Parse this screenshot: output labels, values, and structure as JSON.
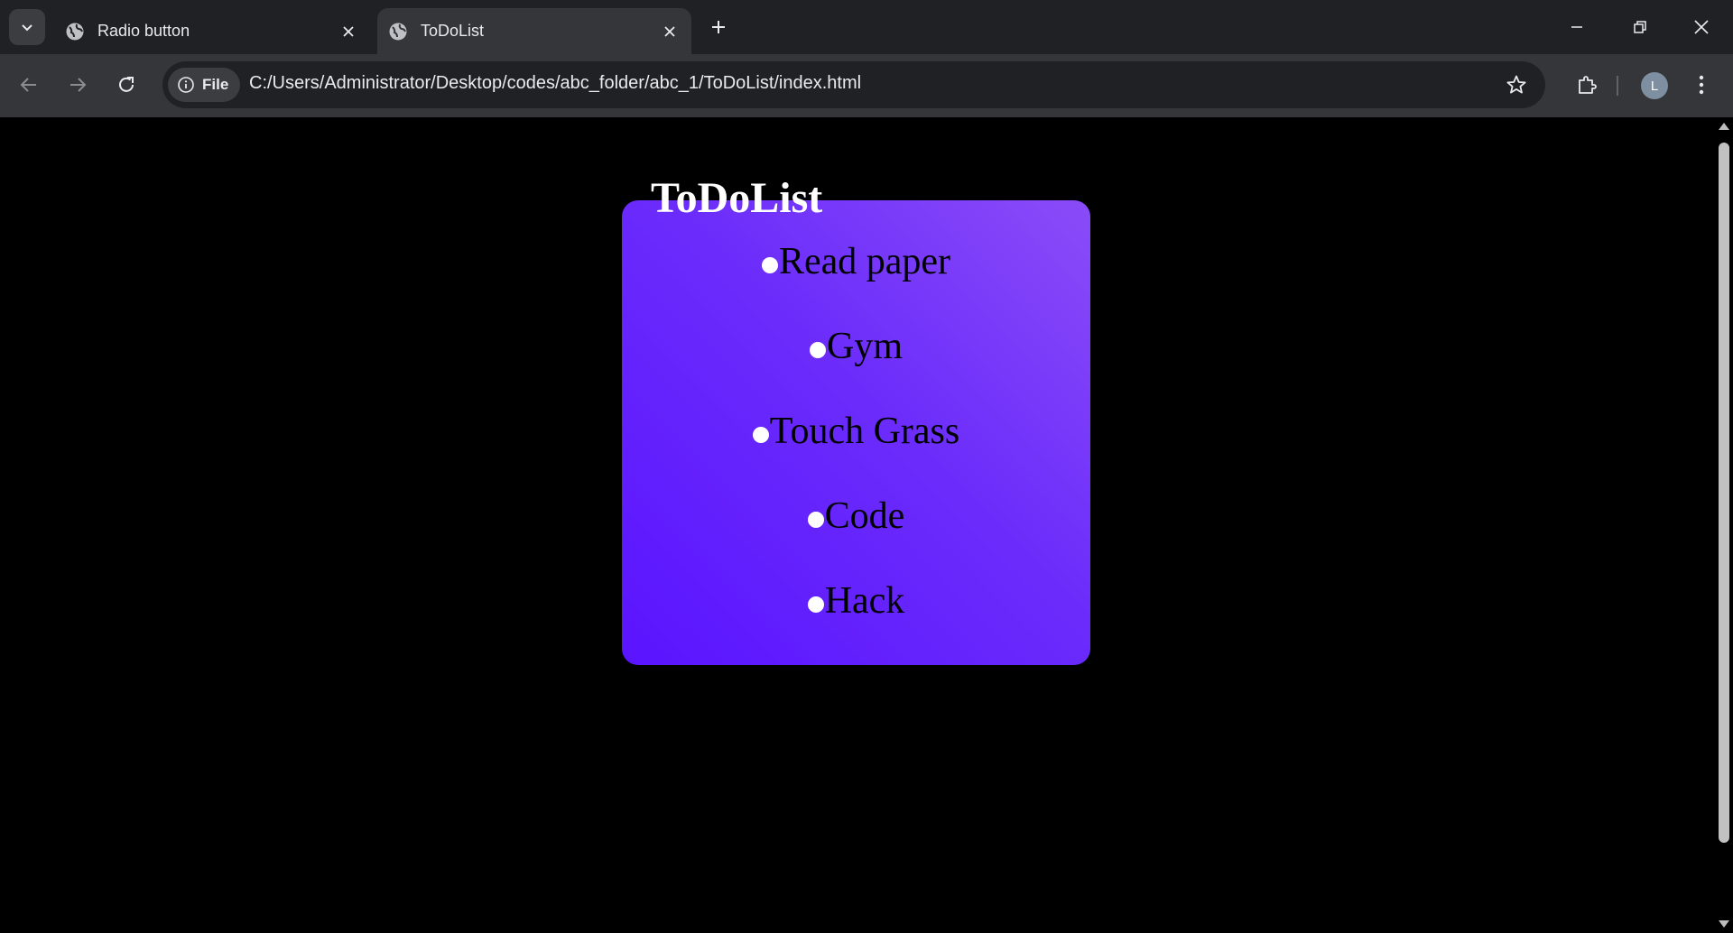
{
  "browser": {
    "tabs": [
      {
        "title": "Radio button",
        "icon": "globe-icon",
        "active": false
      },
      {
        "title": "ToDoList",
        "icon": "globe-icon",
        "active": true
      }
    ],
    "address": {
      "chip_label": "File",
      "url": "C:/Users/Administrator/Desktop/codes/abc_folder/abc_1/ToDoList/index.html"
    },
    "profile_initial": "L"
  },
  "page": {
    "title": "ToDoList",
    "items": [
      {
        "label": "Read paper",
        "checked": false
      },
      {
        "label": "Gym",
        "checked": false
      },
      {
        "label": "Touch Grass",
        "checked": false
      },
      {
        "label": "Code",
        "checked": false
      },
      {
        "label": "Hack",
        "checked": false
      }
    ],
    "colors": {
      "background": "#000000",
      "card_gradient_start": "#5a14ff",
      "card_gradient_end": "#8a4cf7",
      "title": "#ffffff",
      "radio": "#ffffff"
    }
  }
}
